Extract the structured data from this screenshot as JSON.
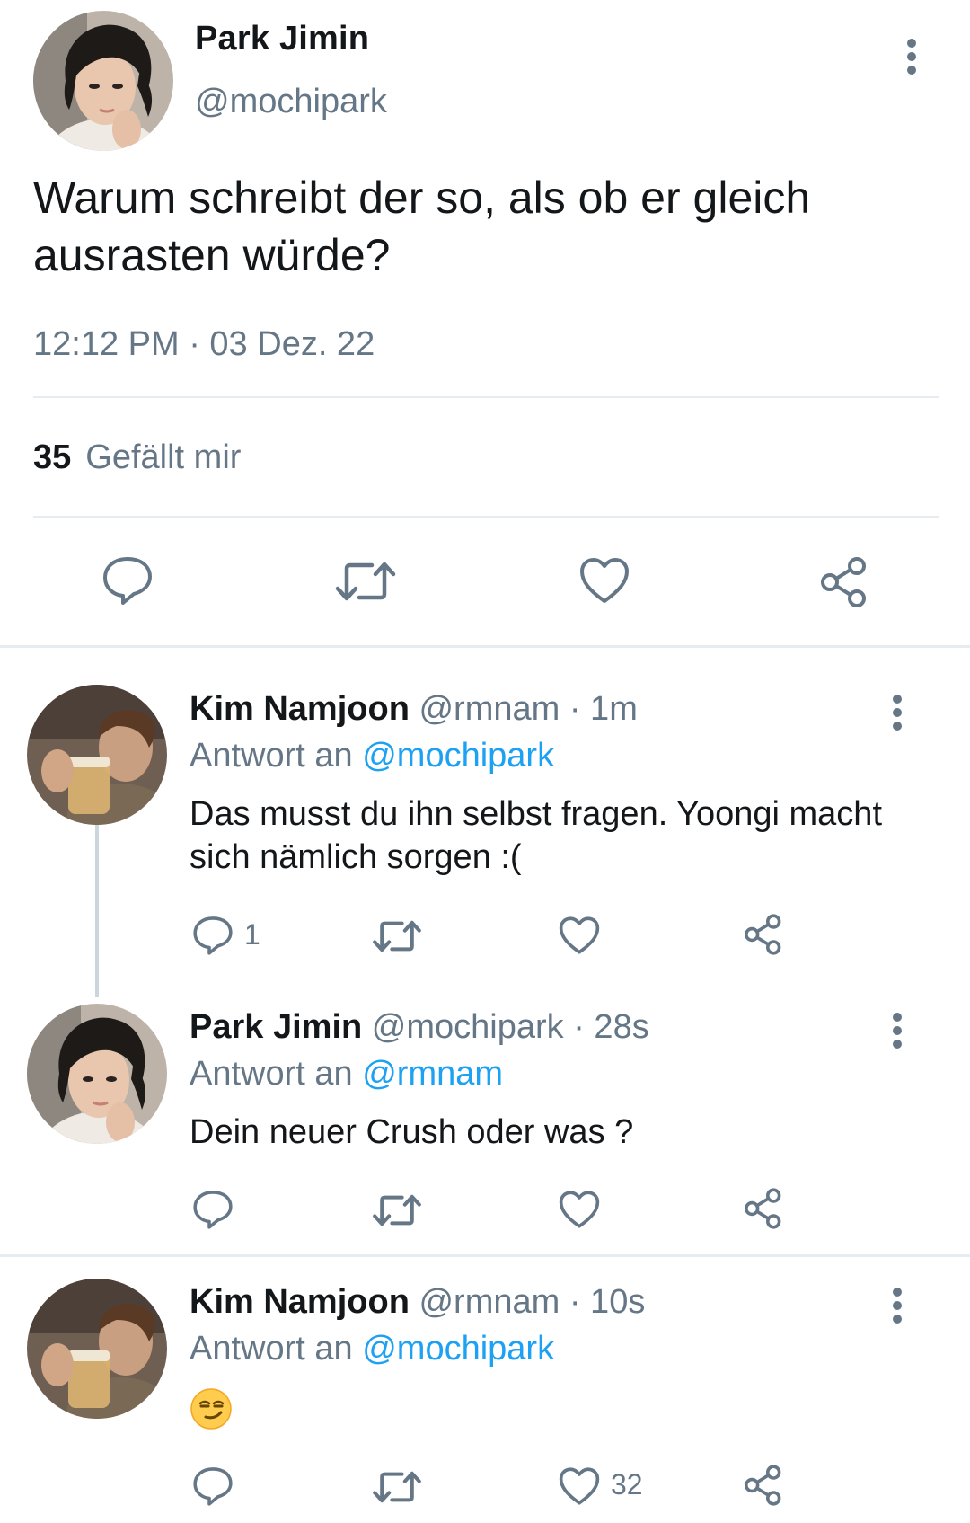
{
  "main_tweet": {
    "author_name": "Park Jimin",
    "author_handle": "@mochipark",
    "text": "Warum schreibt der so, als ob er gleich ausrasten würde?",
    "timestamp": "12:12 PM · 03 Dez. 22",
    "likes_count": "35",
    "likes_label": "Gefällt mir",
    "avatar": "avatar-dark-hair-person",
    "actions": [
      "reply-icon",
      "retweet-icon",
      "like-icon",
      "share-icon"
    ]
  },
  "replies": [
    {
      "author_name": "Kim Namjoon",
      "author_handle": "@rmnam",
      "time": "· 1m",
      "reply_prefix": "Antwort an",
      "reply_to": "@mochipark",
      "text": "Das musst du ihn selbst fragen. Yoongi macht sich nämlich sorgen :(",
      "reply_count": "1",
      "like_count": "",
      "avatar": "avatar-person-holding-drink"
    },
    {
      "author_name": "Park Jimin",
      "author_handle": "@mochipark",
      "time": "· 28s",
      "reply_prefix": "Antwort an",
      "reply_to": "@rmnam",
      "text": "Dein neuer Crush oder was ?",
      "reply_count": "",
      "like_count": "",
      "avatar": "avatar-dark-hair-person"
    },
    {
      "author_name": "Kim Namjoon",
      "author_handle": "@rmnam",
      "time": "· 10s",
      "reply_prefix": "Antwort an",
      "reply_to": "@mochipark",
      "text": "",
      "emoji": "smirking-face-emoji",
      "reply_count": "",
      "like_count": "32",
      "avatar": "avatar-person-holding-drink"
    }
  ],
  "colors": {
    "text": "#14171a",
    "secondary": "#657786",
    "link": "#1da1f2",
    "divider": "#e6ecf0",
    "thread_line": "#ccd6dd"
  }
}
